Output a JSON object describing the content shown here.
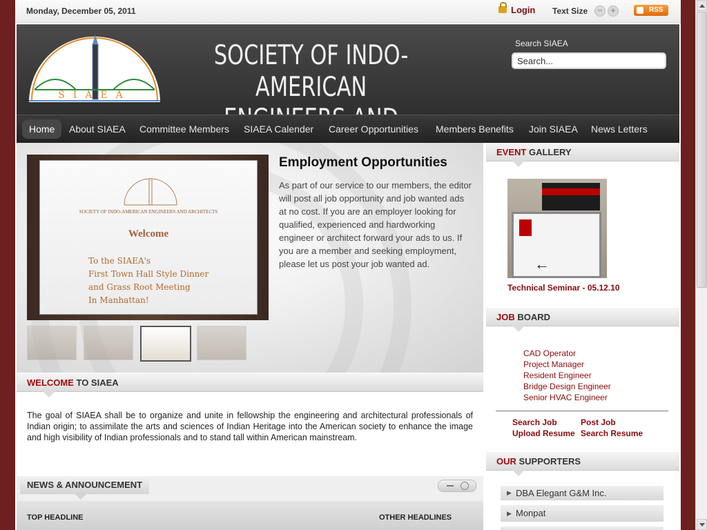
{
  "topbar": {
    "date": "Monday, December 05, 2011",
    "login_label": "Login",
    "text_size_label": "Text Size",
    "decrease_symbol": "−",
    "increase_symbol": "+",
    "rss_label": "RSS"
  },
  "header": {
    "logo_text": "SIAEA",
    "title_line1": "SOCIETY OF INDO-AMERICAN",
    "title_line2": "ENGINEERS AND ARCHITECTS",
    "search_label": "Search SIAEA",
    "search_value": "Search..."
  },
  "nav": {
    "items": [
      {
        "label": "Home"
      },
      {
        "label": "About SIAEA"
      },
      {
        "label": "Committee Members"
      },
      {
        "label": "SIAEA Calender"
      },
      {
        "label": "Career Opportunities"
      },
      {
        "label": "Members Benefits"
      },
      {
        "label": "Join SIAEA"
      },
      {
        "label": "News Letters"
      }
    ]
  },
  "slider": {
    "screen_org": "SOCIETY OF INDO-AMERICAN ENGINEERS AND ARCHITECTS",
    "screen_welcome": "Welcome",
    "screen_body": "To the SIAEA's\nFirst Town Hall Style Dinner\nand Grass Root Meeting\nIn Manhattan!",
    "title": "Employment Opportunities",
    "text": "As part of our service to our members, the editor will post all job opportunity and job wanted ads at no cost. If you are an employer looking for qualified, experienced and hardworking engineer or architect forward your ads to us. If you are a member and seeking employment, please let us post your job wanted ad."
  },
  "welcome": {
    "title_highlight": "WELCOME",
    "title_rest": " TO SIAEA",
    "text": "The goal of SIAEA shall be to organize and unite in fellowship the engineering and architectural professionals of Indian origin; to assimilate the arts and sciences of Indian Heritage into the American society to enhance the image and high visibility of Indian professionals and to stand tall within American mainstream."
  },
  "news": {
    "title": "NEWS & ANNOUNCEMENT",
    "top_headline": "TOP HEADLINE",
    "other_headlines": "OTHER HEADLINES"
  },
  "sidebar": {
    "event": {
      "title_highlight": "EVENT",
      "title_rest": " GALLERY",
      "caption": "Technical Seminar - 05.12.10"
    },
    "jobs": {
      "title_highlight": "JOB",
      "title_rest": " BOARD",
      "items": [
        "CAD Operator",
        "Project Manager",
        "Resident Engineer",
        "Bridge Design Engineer",
        "Senior HVAC Engineer"
      ],
      "search_job": "Search Job",
      "post_job": "Post Job",
      "upload_resume": "Upload Resume",
      "search_resume": "Search Resume"
    },
    "supporters": {
      "title_highlight": "OUR",
      "title_rest": " SUPPORTERS",
      "items": [
        "DBA Elegant G&M Inc.",
        "Monpat"
      ]
    }
  },
  "colors": {
    "accent": "#9b0a0a",
    "header_bg": "#3a3a3a",
    "page_bg": "#6e1f1f"
  }
}
